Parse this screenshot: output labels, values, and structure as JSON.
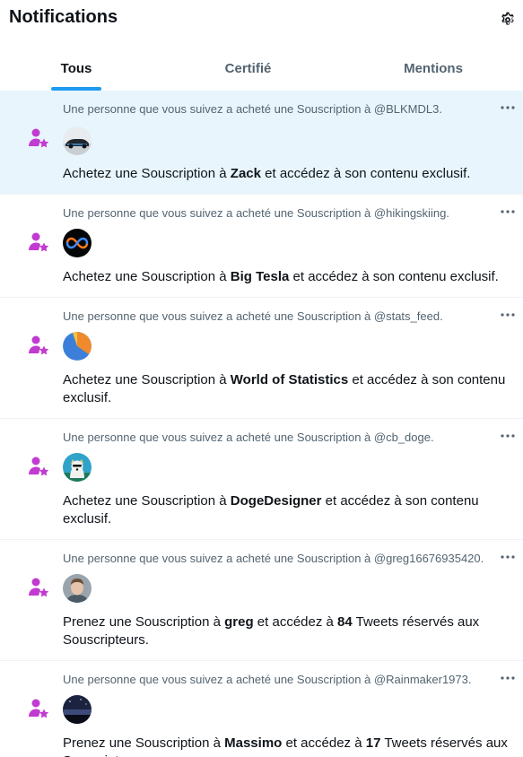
{
  "header": {
    "title": "Notifications",
    "settings_icon": "gear-icon"
  },
  "tabs": [
    {
      "label": "Tous",
      "active": true
    },
    {
      "label": "Certifié",
      "active": false
    },
    {
      "label": "Mentions",
      "active": false
    }
  ],
  "colors": {
    "accent": "#1d9bf0",
    "highlight": "#e8f5fd",
    "subscription_icon": "#c13bd1",
    "muted_text": "#536471"
  },
  "notifications": [
    {
      "context": "Une personne que vous suivez a acheté une Souscription à @BLKMDL3.",
      "pre": "Achetez une Souscription à ",
      "name": "Zack",
      "post": " et accédez à son contenu exclusif.",
      "icon": "subscription-icon",
      "avatar": "car-avatar",
      "highlight": true
    },
    {
      "context": "Une personne que vous suivez a acheté une Souscription à @hikingskiing.",
      "pre": "Achetez une Souscription à ",
      "name": "Big Tesla",
      "post": " et accédez à son contenu exclusif.",
      "icon": "subscription-icon",
      "avatar": "infinity-avatar",
      "highlight": false
    },
    {
      "context": "Une personne que vous suivez a acheté une Souscription à @stats_feed.",
      "pre": "Achetez une Souscription à ",
      "name": "World of Statistics",
      "post": " et accédez à son contenu exclusif.",
      "icon": "subscription-icon",
      "avatar": "pie-chart-avatar",
      "highlight": false
    },
    {
      "context": "Une personne que vous suivez a acheté une Souscription à @cb_doge.",
      "pre": "Achetez une Souscription à ",
      "name": "DogeDesigner",
      "post": " et accédez à son contenu exclusif.",
      "icon": "subscription-icon",
      "avatar": "doge-avatar",
      "highlight": false
    },
    {
      "context": "Une personne que vous suivez a acheté une Souscription à @greg16676935420.",
      "pre": "Prenez une Souscription à ",
      "name": "greg",
      "mid": " et accédez à ",
      "count": "84",
      "post": " Tweets réservés aux Souscripteurs.",
      "icon": "subscription-icon",
      "avatar": "person-avatar",
      "highlight": false
    },
    {
      "context": "Une personne que vous suivez a acheté une Souscription à @Rainmaker1973.",
      "pre": "Prenez une Souscription à ",
      "name": "Massimo",
      "mid": " et accédez à ",
      "count": "17",
      "post": " Tweets réservés aux Souscripteurs.",
      "icon": "subscription-icon",
      "avatar": "night-sky-avatar",
      "highlight": false
    }
  ]
}
